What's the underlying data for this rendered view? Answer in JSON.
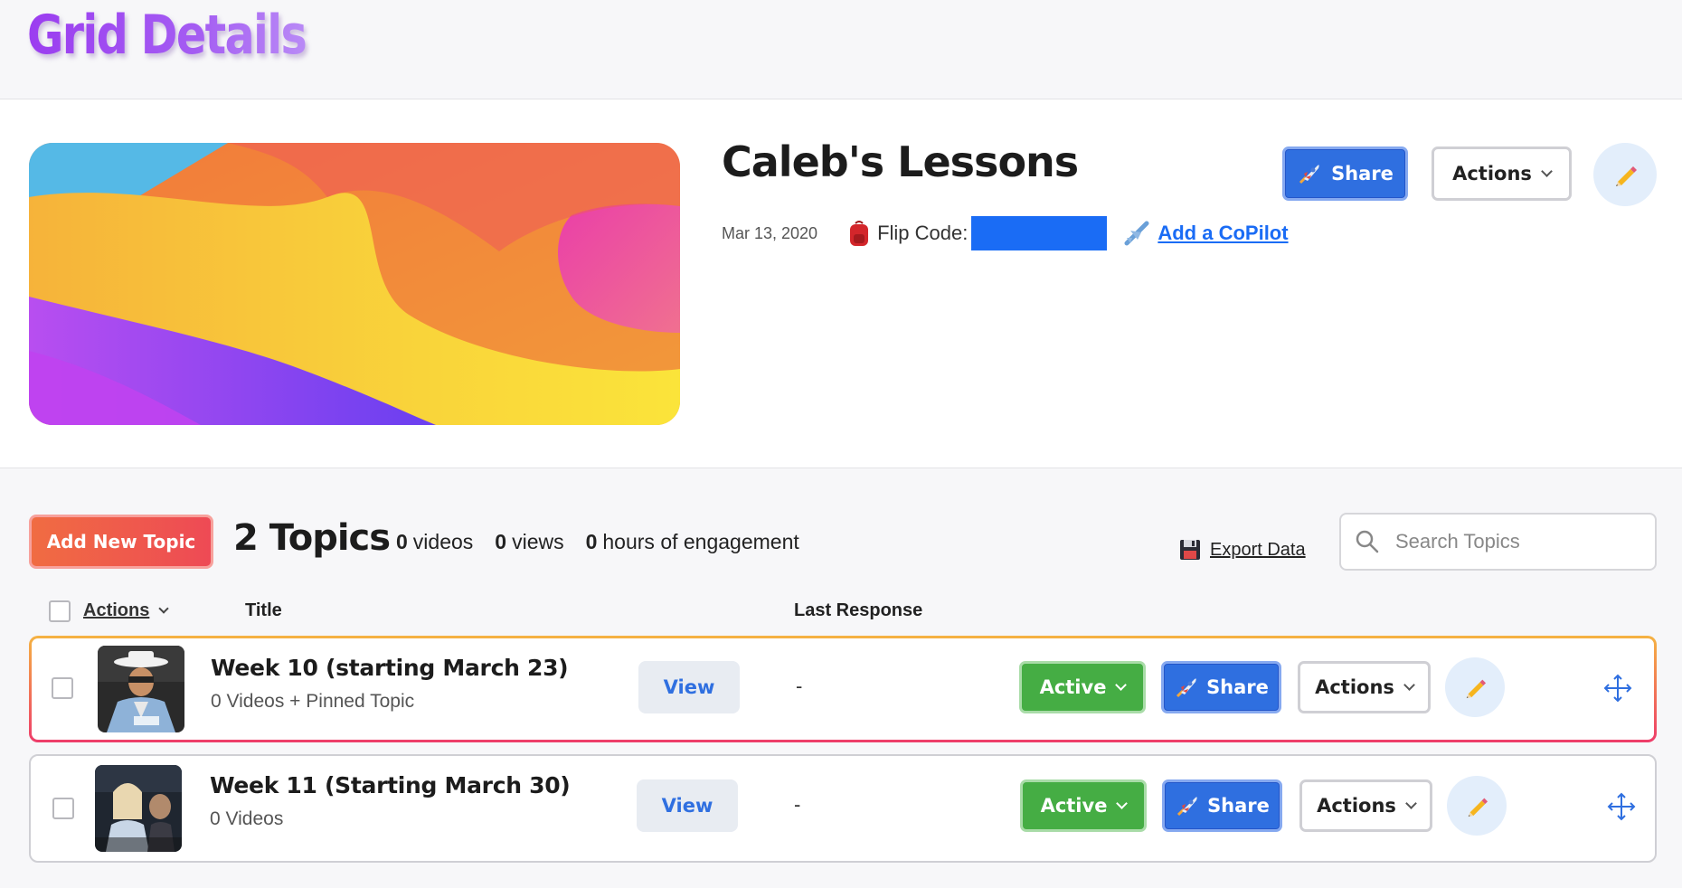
{
  "page": {
    "title": "Grid Details"
  },
  "grid": {
    "name": "Caleb's Lessons",
    "date": "Mar 13, 2020",
    "flip_code_label": "Flip Code:",
    "copilot_label": "Add a CoPilot",
    "share_label": "Share",
    "actions_label": "Actions"
  },
  "topics_header": {
    "add_button": "Add New Topic",
    "count_title": "2 Topics",
    "stats": [
      {
        "value": "0",
        "label": "videos"
      },
      {
        "value": "0",
        "label": "views"
      },
      {
        "value": "0",
        "label": "hours of engagement"
      }
    ],
    "export_label": "Export Data",
    "search_placeholder": "Search Topics"
  },
  "table": {
    "columns": {
      "actions": "Actions",
      "title": "Title",
      "last_response": "Last Response"
    }
  },
  "topics": [
    {
      "title": "Week 10 (starting March 23)",
      "subtitle": "0 Videos + Pinned Topic",
      "view_label": "View",
      "last_response": "-",
      "status": "Active",
      "share_label": "Share",
      "actions_label": "Actions"
    },
    {
      "title": "Week 11 (Starting March 30)",
      "subtitle": "0 Videos",
      "view_label": "View",
      "last_response": "-",
      "status": "Active",
      "share_label": "Share",
      "actions_label": "Actions"
    }
  ],
  "icons": {
    "share": "rocket-icon",
    "edit": "pencil-icon",
    "flip_code": "backpack-icon",
    "copilot": "airplane-icon",
    "export": "floppy-disk-icon",
    "search": "search-icon",
    "move": "move-arrows-icon"
  },
  "colors": {
    "title_purple": "#9b3df0",
    "share_blue": "#2f6fe0",
    "active_green": "#45ad44",
    "add_red": "#f0504a",
    "flip_code_block": "#1a6cf5"
  }
}
